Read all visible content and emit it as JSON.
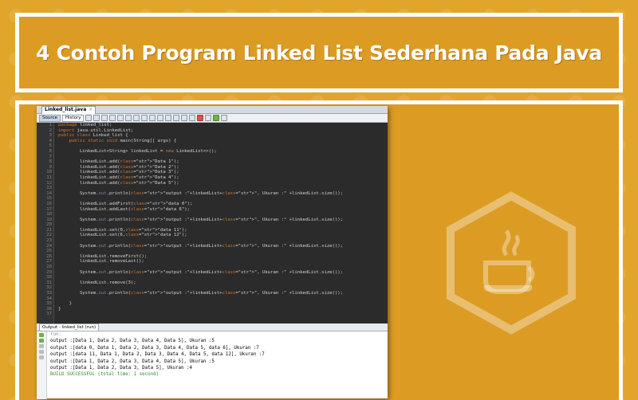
{
  "banner": {
    "title": "4 Contoh Program Linked List Sederhana Pada Java"
  },
  "ide": {
    "file_tab": "Linked_list.java",
    "file_tab_close": "×",
    "toolbar": {
      "source_label": "Source",
      "history_label": "History"
    },
    "line_numbers": [
      "1",
      "2",
      "3",
      "4",
      "5",
      "6",
      "7",
      "8",
      "9",
      "10",
      "11",
      "12",
      "13",
      "14",
      "15",
      "16",
      "17",
      "18",
      "19",
      "20",
      "21",
      "22",
      "23",
      "24",
      "25",
      "26",
      "27",
      "28",
      "29",
      "30",
      "31",
      "32",
      "33",
      "34",
      "35",
      "36",
      "37"
    ],
    "code_lines": [
      "package linked_list;",
      "import java.util.LinkedList;",
      "public class Linked_list {",
      "    public static void main(String[] args) {",
      "",
      "        LinkedList<String> linkedList = new LinkedList<>();",
      "",
      "        linkedList.add(\"Data 1\");",
      "        linkedList.add(\"Data 2\");",
      "        linkedList.add(\"Data 3\");",
      "        linkedList.add(\"Data 4\");",
      "        linkedList.add(\"Data 5\");",
      "",
      "        System.out.println(\"output :\"+linkedList+\", Ukuran :\" +linkedList.size());",
      "",
      "        linkedList.addFirst(\"data 0\");",
      "        linkedList.addLast(\"data 6\");",
      "",
      "        System.out.println(\"output :\"+linkedList+\", Ukuran :\" +linkedList.size());",
      "",
      "        linkedList.set(0,\"data 11\");",
      "        linkedList.set(6,\"data 12\");",
      "",
      "        System.out.println(\"output :\"+linkedList+\", Ukuran :\" +linkedList.size());",
      "",
      "        linkedList.removeFirst();",
      "        linkedList.removeLast();",
      "",
      "        System.out.println(\"output :\"+linkedList+\", Ukuran :\" +linkedList.size());",
      "",
      "        linkedList.remove(3);",
      "",
      "        System.out.println(\"output :\"+linkedList+\", Ukuran :\" +linkedList.size());",
      "",
      "    }",
      "}",
      ""
    ],
    "output_tab": "Output - linked_list (run)",
    "output_lines": [
      "run:",
      "output :[Data 1, Data 2, Data 3, Data 4, Data 5], Ukuran :5",
      "output :[data 0, Data 1, Data 2, Data 3, Data 4, Data 5, data 6], Ukuran :7",
      "output :[data 11, Data 1, Data 2, Data 3, Data 4, Data 5, data 12], Ukuran :7",
      "output :[Data 1, Data 2, Data 3, Data 4, Data 5], Ukuran :5",
      "output :[Data 1, Data 2, Data 3, Data 5], Ukuran :4",
      "BUILD SUCCESSFUL (total time: 1 second)"
    ]
  },
  "colors": {
    "background": "#e2a52c",
    "editor_bg": "#2b2b2b",
    "keyword": "#cc7832",
    "string": "#6a8759",
    "success": "#2e8b2e"
  }
}
